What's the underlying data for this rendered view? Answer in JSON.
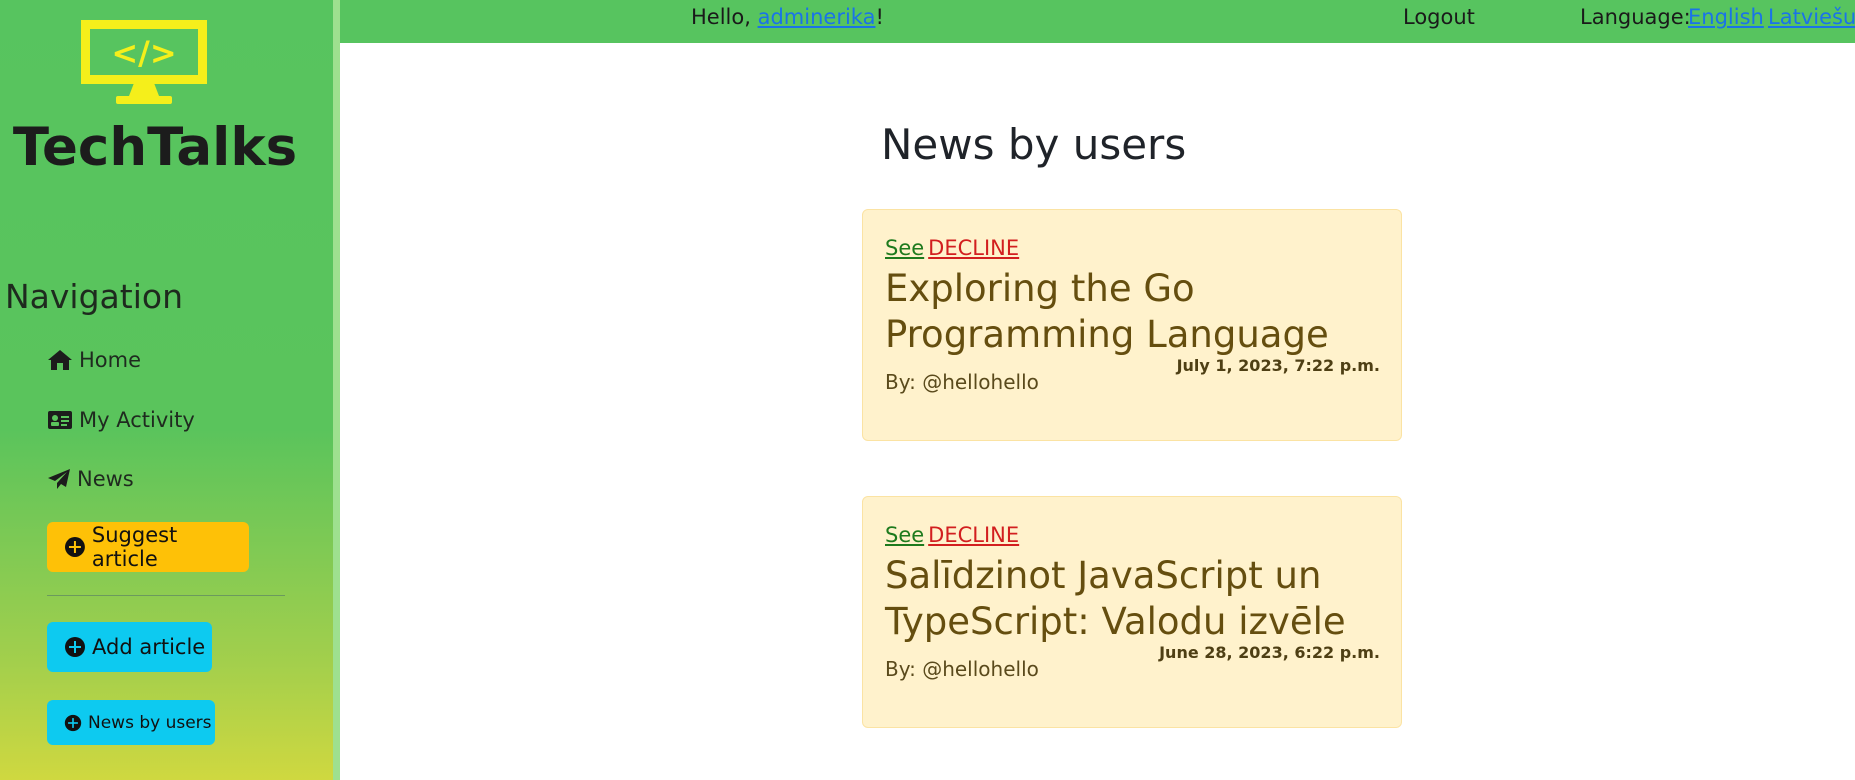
{
  "app": {
    "brand": "TechTalks",
    "logo_text": "</>"
  },
  "topbar": {
    "hello_prefix": "Hello, ",
    "username": "adminerika",
    "hello_suffix": "!",
    "logout_label": "Logout",
    "language_label": "Language:",
    "languages": [
      "English",
      "Latviešu"
    ]
  },
  "sidebar": {
    "heading": "Navigation",
    "items": [
      {
        "label": "Home",
        "icon": "home-icon"
      },
      {
        "label": "My Activity",
        "icon": "id-card-icon"
      },
      {
        "label": "News",
        "icon": "paper-plane-icon"
      }
    ],
    "buttons": {
      "suggest": "Suggest article",
      "add": "Add article",
      "news_by_users": "News by users"
    }
  },
  "main": {
    "title": "News by users",
    "see_label": "See",
    "decline_label": "DECLINE",
    "articles": [
      {
        "title": "Exploring the Go Programming Language",
        "date": "July 1, 2023, 7:22 p.m.",
        "author": "By: @hellohello"
      },
      {
        "title": "Salīdzinot JavaScript un TypeScript: Valodu izvēle",
        "date": "June 28, 2023, 6:22 p.m.",
        "author": "By: @hellohello"
      }
    ]
  },
  "colors": {
    "sidebar_green": "#57c45f",
    "suggest_yellow": "#fec107",
    "cyan": "#0dcaf0",
    "card_bg": "#fff2cc",
    "decline_red": "#d21f1f",
    "see_green": "#1d7a1d"
  }
}
